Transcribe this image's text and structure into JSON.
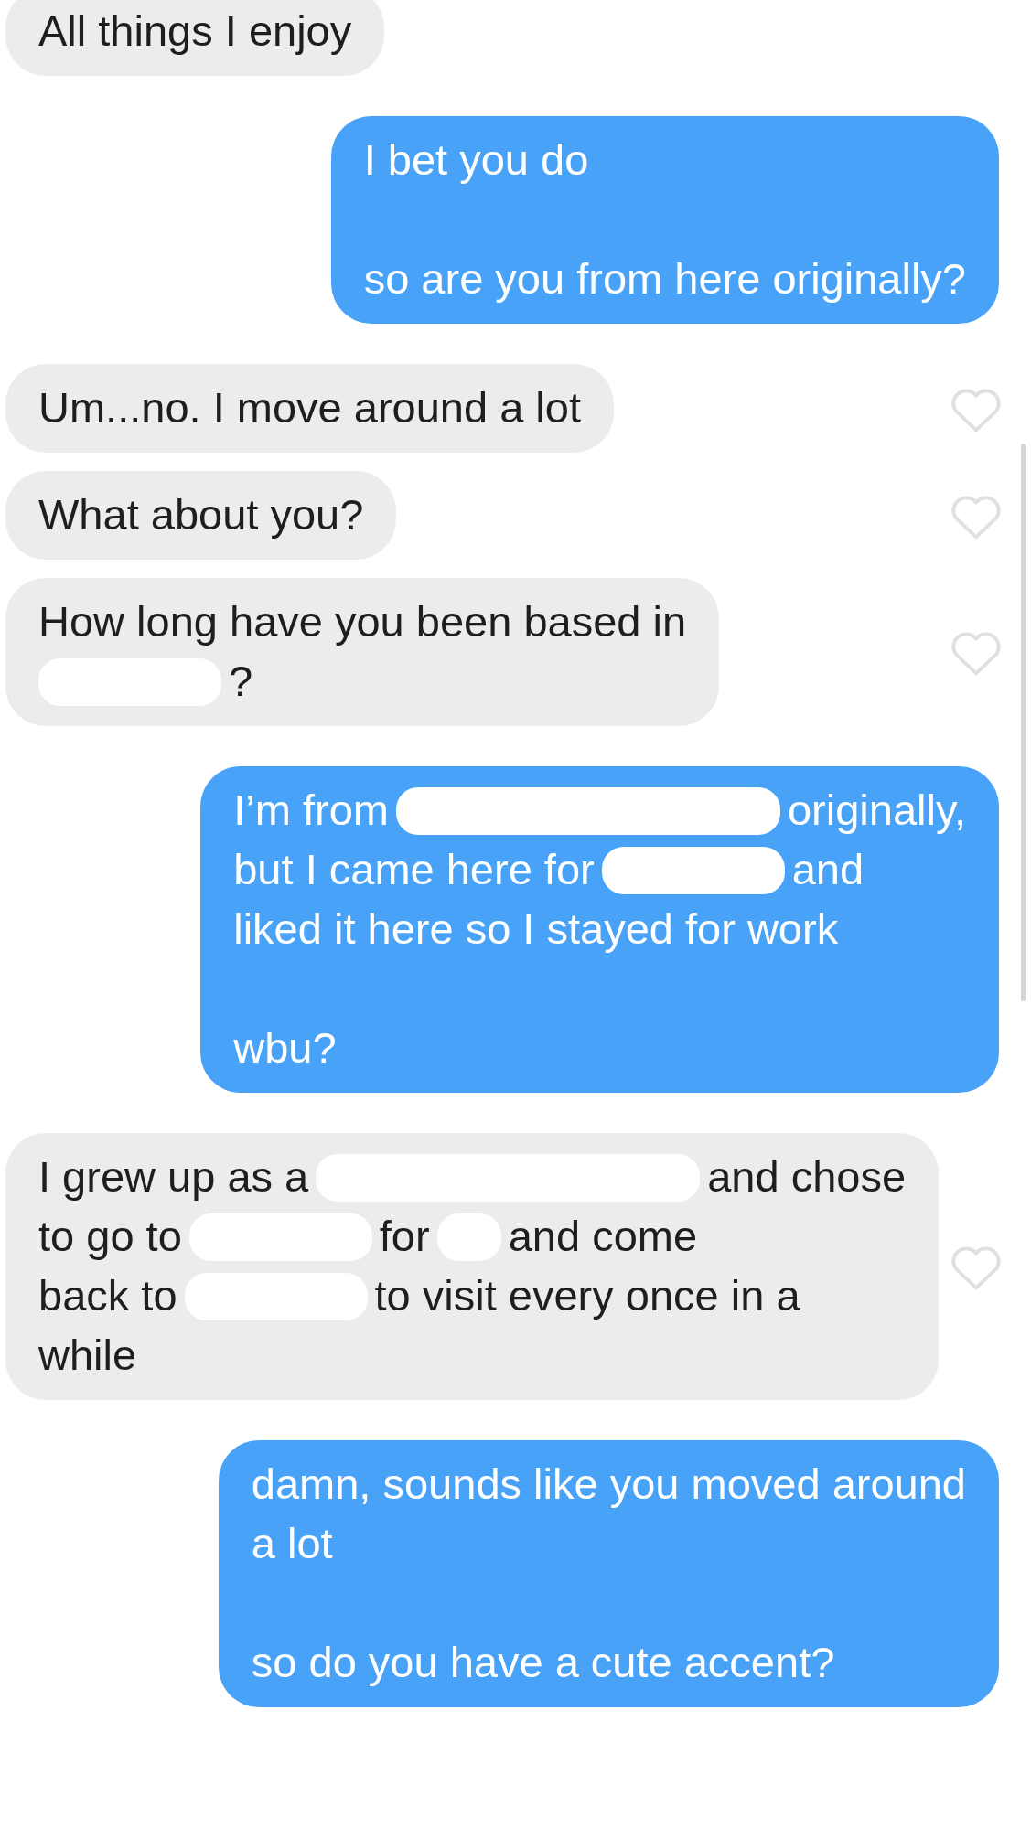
{
  "messages": [
    {
      "sent": false,
      "paragraphs": [
        [
          [
            {
              "kind": "text",
              "text": "All things I enjoy"
            }
          ]
        ]
      ]
    },
    {
      "sent": true,
      "paragraphs": [
        [
          [
            {
              "kind": "text",
              "text": "I bet you do"
            }
          ]
        ],
        [
          [
            {
              "kind": "text",
              "text": "so are you from here originally?"
            }
          ]
        ]
      ]
    },
    {
      "sent": false,
      "liked": false,
      "paragraphs": [
        [
          [
            {
              "kind": "text",
              "text": "Um...no. I move around a lot"
            }
          ]
        ]
      ]
    },
    {
      "sent": false,
      "liked": false,
      "paragraphs": [
        [
          [
            {
              "kind": "text",
              "text": "What about you?"
            }
          ]
        ]
      ]
    },
    {
      "sent": false,
      "liked": false,
      "paragraphs": [
        [
          [
            {
              "kind": "text",
              "text": "How long have you been based in"
            }
          ],
          [
            {
              "kind": "mediumredaction"
            },
            {
              "kind": "text",
              "text": "?"
            }
          ]
        ]
      ]
    },
    {
      "sent": true,
      "paragraphs": [
        [
          [
            {
              "kind": "text",
              "text": "I’m from"
            },
            {
              "kind": "longredaction"
            },
            {
              "kind": "text",
              "text": "originally,"
            }
          ],
          [
            {
              "kind": "text",
              "text": "but I came here for"
            },
            {
              "kind": "mediumredaction"
            },
            {
              "kind": "text",
              "text": "and"
            }
          ],
          [
            {
              "kind": "text",
              "text": "liked it here so I stayed for work"
            }
          ]
        ],
        [
          [
            {
              "kind": "text",
              "text": "wbu?"
            }
          ]
        ]
      ]
    },
    {
      "sent": false,
      "liked": false,
      "paragraphs": [
        [
          [
            {
              "kind": "text",
              "text": "I grew up as a"
            },
            {
              "kind": "longredaction"
            },
            {
              "kind": "text",
              "text": "and chose"
            }
          ],
          [
            {
              "kind": "text",
              "text": "to go to"
            },
            {
              "kind": "mediumredaction"
            },
            {
              "kind": "text",
              "text": "for"
            },
            {
              "kind": "shortredaction"
            },
            {
              "kind": "text",
              "text": "and come"
            }
          ],
          [
            {
              "kind": "text",
              "text": "back to"
            },
            {
              "kind": "mediumredaction"
            },
            {
              "kind": "text",
              "text": "to visit every once in a"
            }
          ],
          [
            {
              "kind": "text",
              "text": "while"
            }
          ]
        ]
      ]
    },
    {
      "sent": true,
      "paragraphs": [
        [
          [
            {
              "kind": "text",
              "text": "damn, sounds like you moved around"
            }
          ],
          [
            {
              "kind": "text",
              "text": "a lot"
            }
          ]
        ],
        [
          [
            {
              "kind": "text",
              "text": "so do you have a cute accent?"
            }
          ]
        ]
      ]
    }
  ]
}
